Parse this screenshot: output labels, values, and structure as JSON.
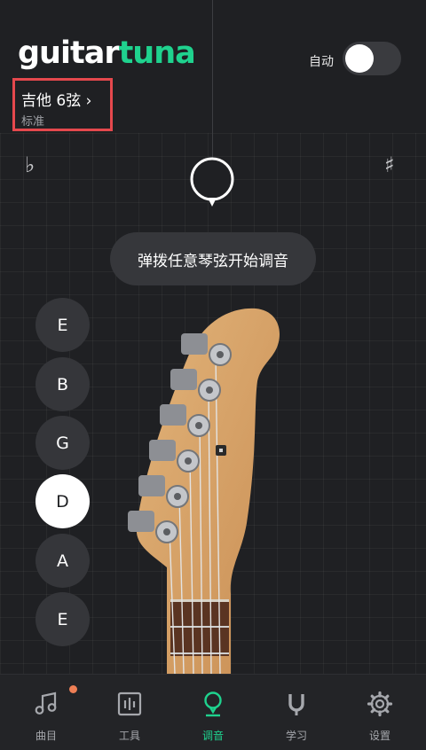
{
  "header": {
    "logo_left": "guitar",
    "logo_right": "tuna",
    "auto_label": "自动",
    "auto_enabled": false
  },
  "tuning": {
    "name": "吉他 6弦",
    "chevron": "›",
    "subtitle": "标准"
  },
  "meter": {
    "flat_symbol": "♭",
    "sharp_symbol": "♯"
  },
  "hint": "弹拨任意琴弦开始调音",
  "strings": [
    {
      "note": "E",
      "active": false
    },
    {
      "note": "B",
      "active": false
    },
    {
      "note": "G",
      "active": false
    },
    {
      "note": "D",
      "active": true
    },
    {
      "note": "A",
      "active": false
    },
    {
      "note": "E",
      "active": false
    }
  ],
  "tabs": [
    {
      "label": "曲目",
      "icon": "music-note-icon",
      "badge": true
    },
    {
      "label": "工具",
      "icon": "tools-icon",
      "badge": false
    },
    {
      "label": "调音",
      "icon": "tuner-icon",
      "badge": false,
      "active": true
    },
    {
      "label": "学习",
      "icon": "magnet-icon",
      "badge": false
    },
    {
      "label": "设置",
      "icon": "gear-icon",
      "badge": false
    }
  ],
  "colors": {
    "background": "#1f2023",
    "accent": "#1fd28e",
    "highlight_border": "#e5484d",
    "badge": "#ee7f55"
  }
}
